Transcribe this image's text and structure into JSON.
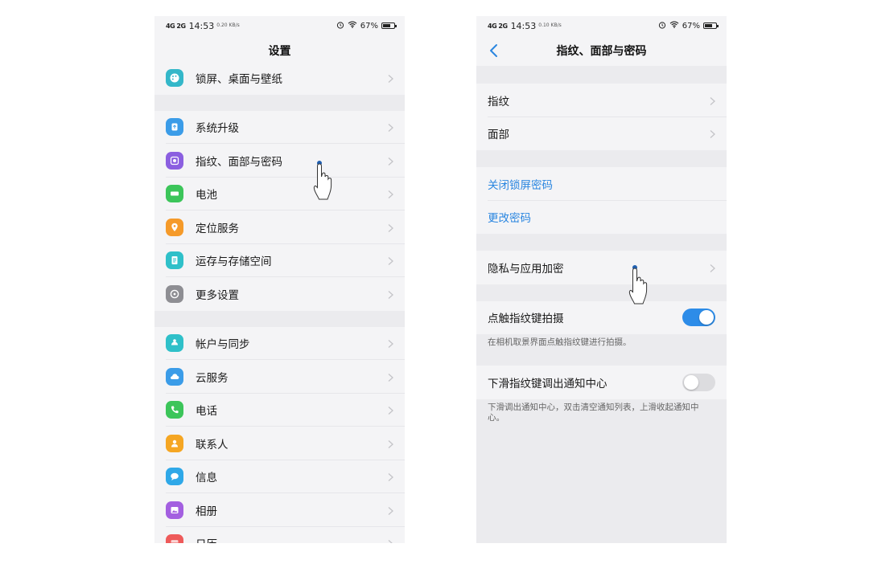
{
  "left_phone": {
    "status": {
      "signal": "4G 2G",
      "time": "14:53",
      "speed": "0.20 KB/s",
      "battery": "67%",
      "battery_level": 0.67
    },
    "title": "设置",
    "groups": [
      [
        {
          "label": "锁屏、桌面与壁纸",
          "icon": "palette-icon",
          "color": "#34b7c9"
        }
      ],
      [
        {
          "label": "系统升级",
          "icon": "system-update-icon",
          "color": "#3b9ce8"
        },
        {
          "label": "指纹、面部与密码",
          "icon": "fingerprint-icon",
          "color": "#8b5fe0"
        },
        {
          "label": "电池",
          "icon": "battery-icon",
          "color": "#3cc55a"
        },
        {
          "label": "定位服务",
          "icon": "location-icon",
          "color": "#f59a2a"
        },
        {
          "label": "运存与存储空间",
          "icon": "storage-icon",
          "color": "#2fc0c9"
        },
        {
          "label": "更多设置",
          "icon": "more-settings-icon",
          "color": "#8e8e93"
        }
      ],
      [
        {
          "label": "帐户与同步",
          "icon": "account-sync-icon",
          "color": "#2fc0c9"
        },
        {
          "label": "云服务",
          "icon": "cloud-icon",
          "color": "#3b9ce8"
        },
        {
          "label": "电话",
          "icon": "phone-icon",
          "color": "#3cc55a"
        },
        {
          "label": "联系人",
          "icon": "contacts-icon",
          "color": "#f5a623"
        },
        {
          "label": "信息",
          "icon": "messages-icon",
          "color": "#2fa8e8"
        },
        {
          "label": "相册",
          "icon": "album-icon",
          "color": "#a35fe0"
        },
        {
          "label": "日历",
          "icon": "calendar-icon",
          "color": "#ee5a5a"
        }
      ]
    ]
  },
  "right_phone": {
    "status": {
      "signal": "4G 2G",
      "time": "14:53",
      "speed": "0.10 KB/s",
      "battery": "67%",
      "battery_level": 0.67
    },
    "title": "指纹、面部与密码",
    "items": {
      "fingerprint": "指纹",
      "face": "面部",
      "disable_lock_password": "关闭锁屏密码",
      "change_password": "更改密码",
      "privacy_app_encryption": "隐私与应用加密",
      "touch_fingerprint_shoot": "点触指纹键拍摄",
      "touch_fingerprint_shoot_hint": "在相机取景界面点触指纹键进行拍摄。",
      "swipe_notification": "下滑指纹键调出通知中心",
      "swipe_notification_hint": "下滑调出通知中心，双击清空通知列表，上滑收起通知中心。"
    },
    "toggles": {
      "touch_fingerprint_shoot": true,
      "swipe_notification": false
    }
  },
  "colors": {
    "accent": "#2a86e0",
    "toggle_on": "#2d8ce8"
  }
}
